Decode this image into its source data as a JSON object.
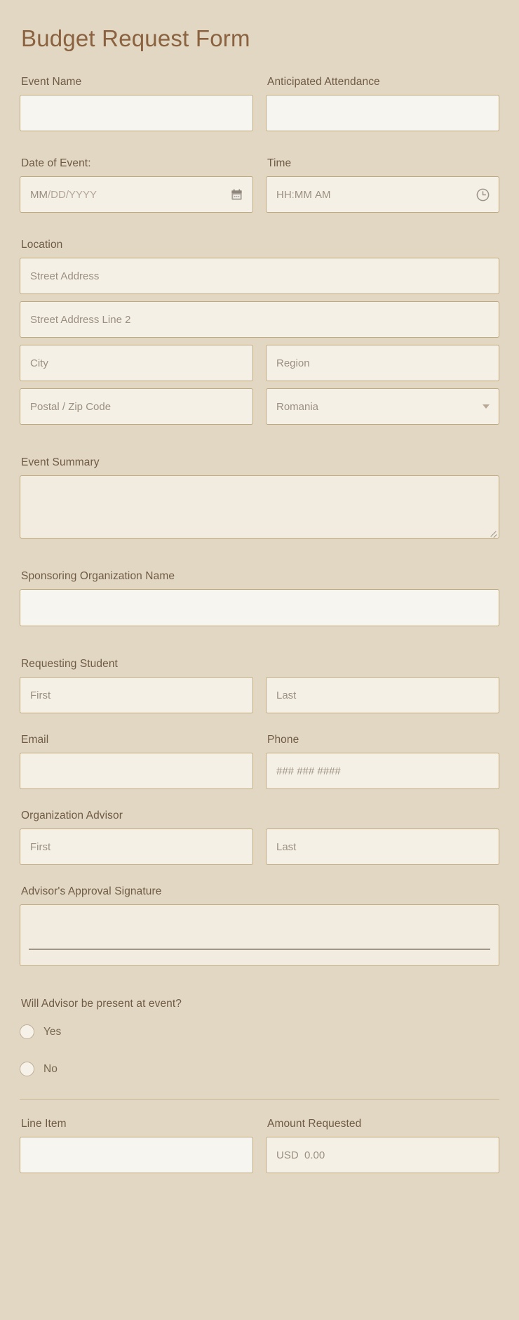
{
  "form": {
    "title": "Budget Request Form"
  },
  "fields": {
    "event_name": {
      "label": "Event Name",
      "value": "",
      "placeholder": ""
    },
    "anticipated_attendance": {
      "label": "Anticipated Attendance",
      "value": "",
      "placeholder": ""
    },
    "date_of_event": {
      "label": "Date of Event:",
      "placeholder_mm": "MM",
      "placeholder_sep1": "/",
      "placeholder_dd": "DD",
      "placeholder_sep2": "/",
      "placeholder_yyyy": "YYYY",
      "icon": "calendar-icon"
    },
    "time": {
      "label": "Time",
      "placeholder_hh": "HH",
      "placeholder_sep": ":",
      "placeholder_mm": "MM",
      "placeholder_ampm": "AM",
      "icon": "clock-icon"
    },
    "location": {
      "label": "Location",
      "street_address": {
        "placeholder": "Street Address"
      },
      "street_address_2": {
        "placeholder": "Street Address Line 2"
      },
      "city": {
        "placeholder": "City"
      },
      "region": {
        "placeholder": "Region"
      },
      "postal": {
        "placeholder": "Postal / Zip Code"
      },
      "country": {
        "value": "Romania",
        "icon": "chevron-down-icon"
      }
    },
    "event_summary": {
      "label": "Event Summary",
      "value": ""
    },
    "sponsoring_organization_name": {
      "label": "Sponsoring Organization Name",
      "value": ""
    },
    "requesting_student": {
      "label": "Requesting Student",
      "first": {
        "placeholder": "First"
      },
      "last": {
        "placeholder": "Last"
      }
    },
    "email": {
      "label": "Email",
      "value": "",
      "placeholder": ""
    },
    "phone": {
      "label": "Phone",
      "placeholder": "### ### ####"
    },
    "organization_advisor": {
      "label": "Organization Advisor",
      "first": {
        "placeholder": "First"
      },
      "last": {
        "placeholder": "Last"
      }
    },
    "advisor_signature": {
      "label": "Advisor's Approval Signature"
    },
    "advisor_present": {
      "label": "Will Advisor be present at event?",
      "options": [
        {
          "label": "Yes",
          "selected": false
        },
        {
          "label": "No",
          "selected": false
        }
      ]
    },
    "line_item": {
      "label": "Line Item",
      "value": ""
    },
    "amount_requested": {
      "label": "Amount Requested",
      "currency": "USD",
      "placeholder": "0.00"
    }
  },
  "colors": {
    "page_background": "#e2d7c3",
    "title": "#8a6240",
    "label": "#6f5b45",
    "field_border": "#bfa97f",
    "field_fill_tinted": "#f5f0e6",
    "field_fill_white": "#f7f5ef",
    "placeholder": "#9a8f80",
    "divider": "#c9b893"
  }
}
